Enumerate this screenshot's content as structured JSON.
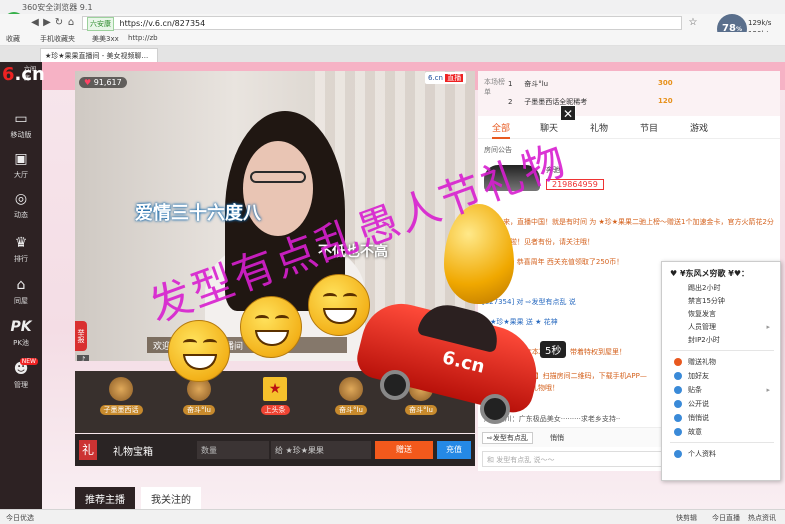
{
  "browser": {
    "title": "360安全浏览器 9.1",
    "logo": "e",
    "nav": [
      "◀",
      "▶",
      "↻",
      "⌂",
      "☆"
    ],
    "address_badge": "六安康",
    "url": "https://v.6.cn/827354",
    "bookmarks": [
      "收藏",
      "手机收藏夹",
      "美美3xx",
      "http://zb"
    ],
    "tab_label": "★珍★果果直播间 - 美女视频聊...",
    "speed": "78",
    "speed_unit": "%",
    "net_up": "129k/s",
    "net_down": "126k/s"
  },
  "sidebar": {
    "logo_six": "6",
    "logo_cn": ".cn",
    "logo_sub": "六间房",
    "items": [
      {
        "icon": "▭",
        "label": "移动版"
      },
      {
        "icon": "▣",
        "label": "大厅"
      },
      {
        "icon": "◎",
        "label": "动态"
      },
      {
        "icon": "♛",
        "label": "排行"
      },
      {
        "icon": "⌂",
        "label": "同屋"
      },
      {
        "icon": "PK",
        "label": "PK池"
      },
      {
        "icon": "☻",
        "label": "管理",
        "badge": "NEW"
      }
    ]
  },
  "video": {
    "viewers": "91,617",
    "site_tag": "6.cn",
    "live_tag": "直播",
    "caption_main": "爱情三十六度八",
    "caption_sub": "不低也不高",
    "banner": "欢迎来到珍果果直播间",
    "report": "举报",
    "mic": "♪",
    "timer": "5秒",
    "car_logo": "6.cn"
  },
  "gifts": [
    {
      "name": "子墨墨西话",
      "top": false
    },
    {
      "name": "奋斗°lu",
      "top": false
    },
    {
      "name": "上头条",
      "top": true
    },
    {
      "name": "奋斗°lu",
      "top": false
    },
    {
      "name": "奋斗°lu",
      "top": false
    }
  ],
  "gift_bar": {
    "icon": "礼",
    "title": "礼物宝箱",
    "qty_placeholder": "数量",
    "to_label": "给 ★珍★果果",
    "send": "赠送",
    "recharge": "充值"
  },
  "bottom_tabs": [
    "推荐主播",
    "我关注的"
  ],
  "right_panel": {
    "rank_label": "本场榜单",
    "rank_rows": [
      {
        "num": "1",
        "name": "奋斗°lu",
        "score": "300"
      },
      {
        "num": "2",
        "name": "子墨墨西话全昵稀考",
        "score": "120"
      }
    ],
    "close": "✕",
    "tabs": [
      "全部",
      "聊天",
      "礼物",
      "节目",
      "游戏"
    ],
    "notice": "房间公告",
    "car_name": "奔驰",
    "car_id": "219864959",
    "chat": [
      {
        "text": "快来快来，直播中国！就是有时间 为 ★珍★果果二驰上榜～赠送1个加速金卡，官方火箭花2分",
        "style": ""
      },
      {
        "text": "钟后进去啦！见者有份，请关注哦！",
        "style": ""
      },
      {
        "text": "今天第6场 恭喜周年 西关充值领取了250币！",
        "style": ""
      },
      {
        "text": "[827354] 对 ⇨发型有点乱 说",
        "style": "blue"
      },
      {
        "text": "⇨ ★珍★果果 送 ★ 花神",
        "style": "blue"
      },
      {
        "text": "系统消息: 你的\"本次功能\"，带着特权到屋里！",
        "style": ""
      },
      {
        "text": "系统消息: 【充值】扫描房间二维码，下载手机APP— ",
        "style": ""
      },
      {
        "text": "话可以领取免费礼物哦！",
        "style": ""
      }
    ],
    "ad": "厂 | 四川：广东极品美女·········求老乡支持··",
    "to_select": "⇨发型有点乱",
    "private": "悄悄",
    "input_placeholder": "和 发型有点乱 说～～"
  },
  "context_menu": {
    "title": "♥ ¥东风メ穷歌 ¥♥：",
    "items": [
      {
        "label": "踢出2小时",
        "arrow": false
      },
      {
        "label": "禁言15分钟",
        "arrow": false
      },
      {
        "label": "恢复发言",
        "arrow": false
      },
      {
        "label": "人员管理",
        "arrow": true
      },
      {
        "label": "封IP2小时",
        "arrow": false
      },
      {
        "label": "赠送礼物",
        "arrow": false,
        "icon": "#e8581f"
      },
      {
        "label": "加好友",
        "arrow": false,
        "icon": "#3a8ad8"
      },
      {
        "label": "贴条",
        "arrow": true,
        "icon": "#3a8ad8"
      },
      {
        "label": "公开说",
        "arrow": false,
        "icon": "#3a8ad8"
      },
      {
        "label": "悄悄说",
        "arrow": false,
        "icon": "#3a8ad8"
      },
      {
        "label": "故意",
        "arrow": false,
        "icon": "#3a8ad8"
      },
      {
        "label": "个人资料",
        "arrow": false,
        "icon": "#3a8ad8"
      }
    ]
  },
  "watermark": "发型有点乱愚人节礼物",
  "statusbar": {
    "left": "今日优选",
    "r1": "快剪辑",
    "r2": "今日直播",
    "r3": "热点资讯"
  },
  "colors": {
    "accent_orange": "#f2591c",
    "sidebar_dark": "#2d2223",
    "watermark_magenta": "#d81fd0",
    "recharge_blue": "#2589e6"
  }
}
